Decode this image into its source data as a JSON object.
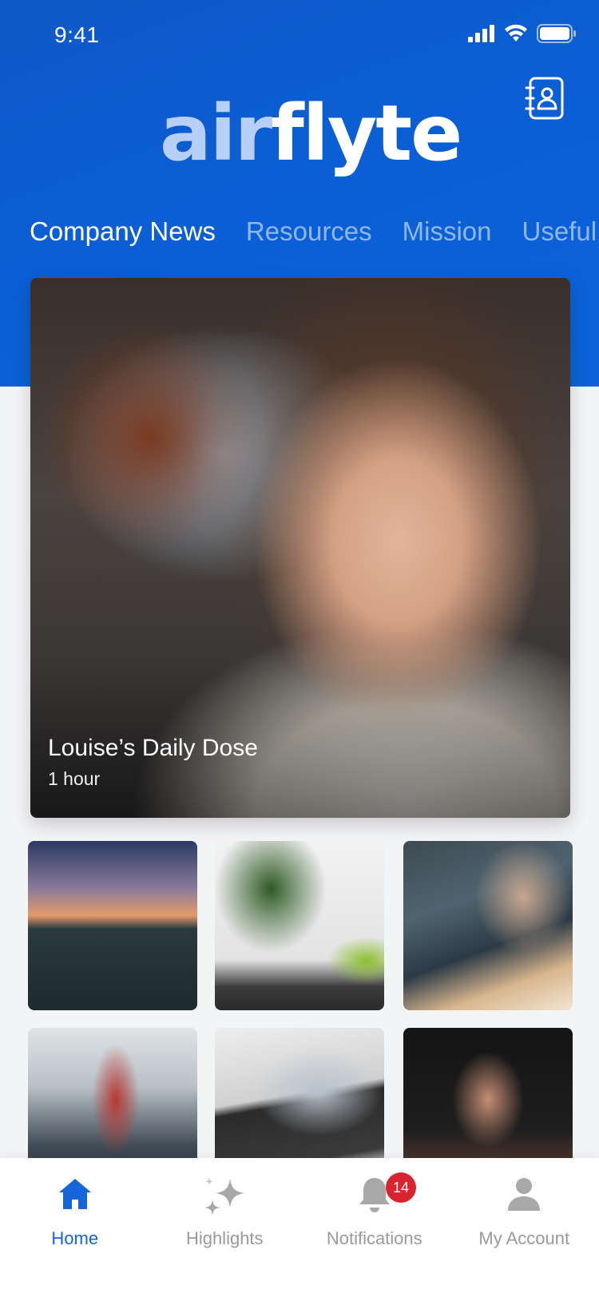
{
  "status_bar": {
    "time": "9:41"
  },
  "header": {
    "logo_light": "air",
    "logo_bold": "flyte",
    "contacts_icon": "contact-book-icon"
  },
  "tabs": [
    {
      "label": "Company News",
      "active": true
    },
    {
      "label": "Resources",
      "active": false
    },
    {
      "label": "Mission",
      "active": false
    },
    {
      "label": "Useful",
      "active": false
    }
  ],
  "feature": {
    "title": "Louise’s Daily Dose",
    "meta": "1 hour"
  },
  "thumbnails": [
    {
      "subject": "airplane at sunset"
    },
    {
      "subject": "plant and laptop"
    },
    {
      "subject": "team meeting"
    },
    {
      "subject": "cabin crew aisle"
    },
    {
      "subject": "laptop video"
    },
    {
      "subject": "man with sunglasses"
    }
  ],
  "bottom_nav": {
    "home": "Home",
    "highlights": "Highlights",
    "notifications": "Notifications",
    "notifications_count": "14",
    "account": "My Account"
  },
  "colors": {
    "brand_blue": "#0c5fd6",
    "active_tab": "#ffffff",
    "inactive_tab": "#8fb4ef",
    "badge": "#d8242f",
    "nav_active": "#1565d8"
  }
}
